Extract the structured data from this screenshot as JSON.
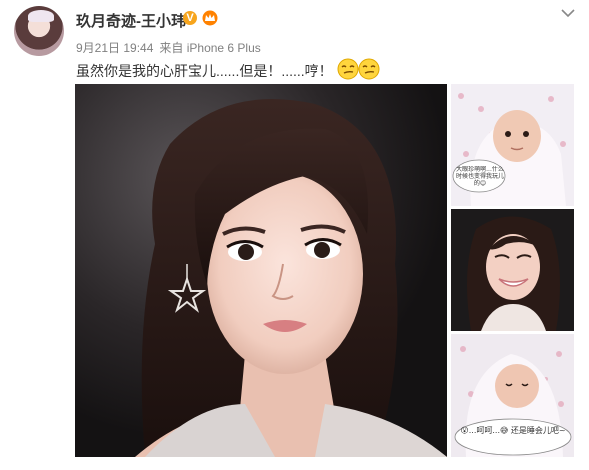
{
  "post": {
    "author": "玖月奇迹-王小玮",
    "verified_badge": "V",
    "time": "9月21日 19:44",
    "via": "来自 iPhone 6 Plus",
    "text": "虽然你是我的心肝宝儿......但是！......哼！"
  },
  "icons": {
    "avatar": "user-avatar",
    "verified": "verified-v-icon",
    "member": "member-crown-icon",
    "menu": "chevron-down-icon",
    "emoji1": "smirk-emoji-icon",
    "emoji2": "smirk-emoji-icon"
  },
  "images": {
    "main": "selfie-photo",
    "thumb1": "baby-photo-1",
    "thumb1_bubble": "大眼珍萌啊...什么时候也变得我玩儿的😊",
    "thumb2": "mother-smiling-photo",
    "thumb3": "baby-photo-2",
    "thumb3_bubble": "😮...呵呵...😅 还是睡会儿吧~"
  },
  "colors": {
    "link": "#333333",
    "meta": "#808080",
    "badge": "#f7a51d",
    "member_icon": "#ff8200"
  }
}
